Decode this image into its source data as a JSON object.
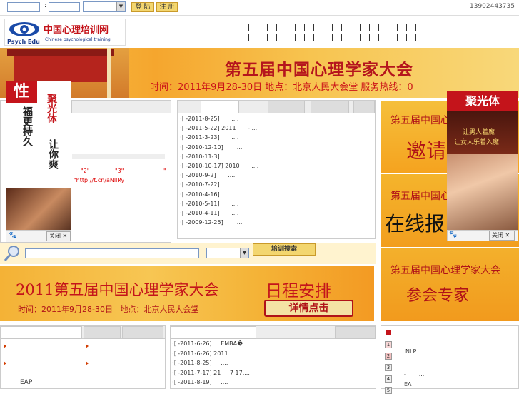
{
  "topbar": {
    "separator": ":",
    "login_label": "登 陆",
    "register_label": "注 册",
    "phone": "13902443735"
  },
  "logo": {
    "en": "Psych Edu",
    "cn": "中国心理培训网",
    "tagline": "Chinese psychological training"
  },
  "banner": {
    "title": "第五届中国心理学家大会",
    "subtitle": "时间：2011年9月28-30日 地点：北京人民大会堂 服务热线：0"
  },
  "left_ad": {
    "badge": "性",
    "line1": "聚光体",
    "line2": "福更持久",
    "line3": "让你爽",
    "close": "关闭"
  },
  "left_panel": {
    "quote2": "\"2\"",
    "quote3": "\"3\"",
    "dot": "\"",
    "link": "\"http://t.cn/aNllRy"
  },
  "news_list": [
    {
      "date": "-2011-8-25]",
      "text": "...."
    },
    {
      "date": "-2011-5-22] 2011",
      "text": "- ...."
    },
    {
      "date": "-2011-3-23]",
      "text": "...."
    },
    {
      "date": "-2010-12-10]",
      "text": "...."
    },
    {
      "date": "-2010-11-3]",
      "text": ""
    },
    {
      "date": "-2010-10-17] 2010",
      "text": "...."
    },
    {
      "date": "-2010-9-2]",
      "text": "...."
    },
    {
      "date": "-2010-7-22]",
      "text": "...."
    },
    {
      "date": "-2010-4-16]",
      "text": "...."
    },
    {
      "date": "-2010-5-11]",
      "text": "...."
    },
    {
      "date": "-2010-4-11]",
      "text": "...."
    },
    {
      "date": "-2009-12-25]",
      "text": "...."
    }
  ],
  "search": {
    "button": "培训搜索"
  },
  "banner2": {
    "title": "2011第五届中国心理学家大会",
    "schedule": "日程安排",
    "info": "时间：2011年9月28-30日   地点：北京人民大会堂",
    "detail_button": "详情点击"
  },
  "right_column": {
    "box1_title": "第五届中国心",
    "box1_big": "邀请",
    "box2_title": "第五届中国心",
    "box2_big": "在线报",
    "box3_title": "第五届中国心理学家大会",
    "box3_big": "参会专家"
  },
  "right_ad": {
    "title": "聚光体",
    "line1": "让男人着魔",
    "line2": "让女人乐着入魔",
    "close": "关闭"
  },
  "bottom_left": {
    "item_eap": "EAP"
  },
  "bottom_list": [
    {
      "date": "-2011-6-26]",
      "text": "EMBA�  ...."
    },
    {
      "date": "-2011-6-26] 2011",
      "text": "...."
    },
    {
      "date": "-2011-8-25]",
      "text": "...."
    },
    {
      "date": "-2011-7-17]  21",
      "text": "7 17...."
    },
    {
      "date": "-2011-8-19]",
      "text": "...."
    }
  ],
  "bottom_right": {
    "items": [
      "....",
      "NLP     ....",
      "....",
      "-      ....",
      "EA"
    ],
    "nums": [
      "1",
      "2",
      "3",
      "4",
      "5"
    ]
  },
  "colors": {
    "brand_red": "#c4141b",
    "banner_orange": "#f5a62e",
    "search_bg": "#fff3cf"
  }
}
